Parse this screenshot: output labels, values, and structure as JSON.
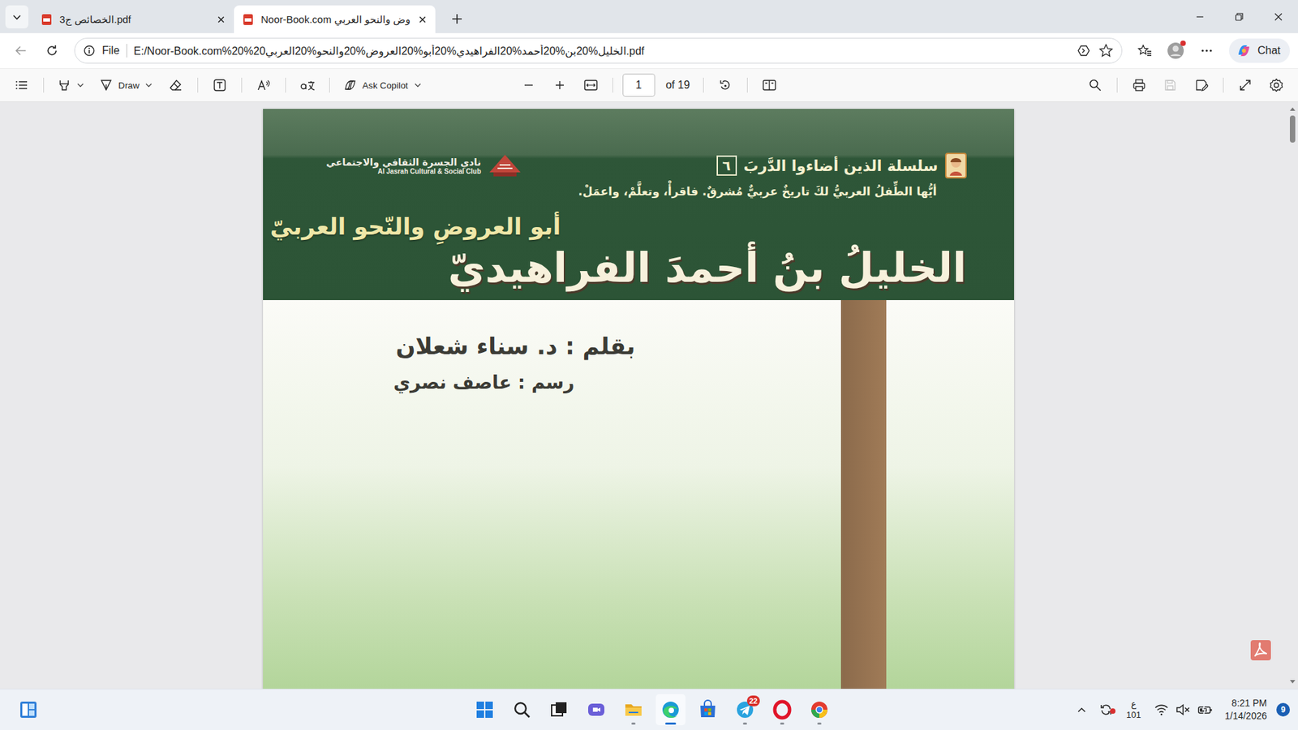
{
  "tabs": [
    {
      "label": "الخصائص ج3.pdf",
      "selected": false
    },
    {
      "label": "Noor-Book.com وض والنحو العربي",
      "selected": true
    }
  ],
  "address": {
    "scheme": "File",
    "url": "E:/Noor-Book.com%20%20الخليل%20بن%20أحمد%20الفراهيدي%20أبو%20العروض%20والنحو%20العربي.pdf"
  },
  "profile": {
    "alert": true
  },
  "chat_button": {
    "label": "Chat"
  },
  "pdf_toolbar": {
    "draw": "Draw",
    "ask": "Ask Copilot",
    "page": "1",
    "total": "of 19",
    "save_disabled": true
  },
  "document": {
    "series": "سلسلة الذين أضاءوا الدَّربَ",
    "series_number": "٦",
    "motto": "أيُّها الطِّفلُ العربيُّ لكَ تاريخٌ عربيٌّ مُشرقٌ. فاقرأْ، وتعلَّمْ، واعمَلْ.",
    "publisher_ar": "نادي الجسرة الثقافي والاجتماعي",
    "publisher_en": "Al Jasrah Cultural & Social Club",
    "subtitle": "أبو العروضِ والنّحو العربيّ",
    "title": "الخليلُ بنُ أحمدَ الفراهيديّ",
    "author": "بقلم : د. سناء شعلان",
    "illustrator": "رسم : عاصف نصري"
  },
  "taskbar": {
    "apps": [
      {
        "running": false,
        "active": false
      },
      {
        "running": false,
        "active": false
      },
      {
        "running": false,
        "active": false
      },
      {
        "running": false,
        "active": false
      },
      {
        "running": true,
        "active": false
      },
      {
        "running": true,
        "active": true
      },
      {
        "running": false,
        "active": false
      },
      {
        "running": true,
        "active": false,
        "badge": "22"
      },
      {
        "running": true,
        "active": false
      },
      {
        "running": true,
        "active": false
      }
    ],
    "tray": {
      "sync_alert": true,
      "language": "ع",
      "language_sub": "101",
      "muted": true,
      "time": "8:21 PM",
      "date": "1/14/2026",
      "notifications": "9"
    }
  }
}
